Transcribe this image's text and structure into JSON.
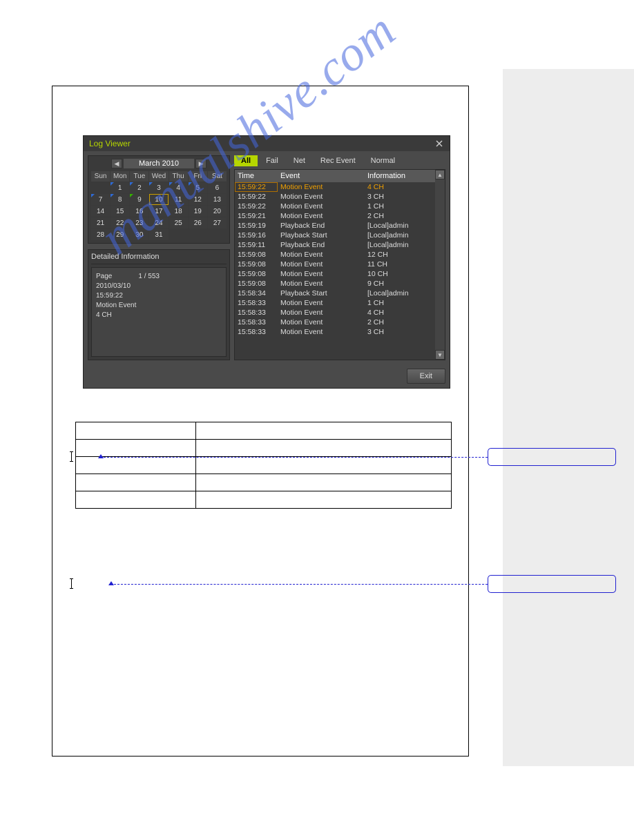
{
  "window": {
    "title": "Log Viewer",
    "exit_label": "Exit"
  },
  "calendar": {
    "month_label": "March 2010",
    "dow": [
      "Sun",
      "Mon",
      "Tue",
      "Wed",
      "Thu",
      "Fri",
      "Sat"
    ],
    "weeks": [
      [
        null,
        {
          "d": "1",
          "m": "blue"
        },
        {
          "d": "2",
          "m": "blue"
        },
        {
          "d": "3",
          "m": "blue"
        },
        {
          "d": "4",
          "m": "blue"
        },
        {
          "d": "5",
          "m": "blue"
        },
        {
          "d": "6"
        }
      ],
      [
        {
          "d": "7",
          "m": "blue"
        },
        {
          "d": "8",
          "m": "blue"
        },
        {
          "d": "9",
          "m": "green"
        },
        {
          "d": "10",
          "sel": true
        },
        {
          "d": "11"
        },
        {
          "d": "12"
        },
        {
          "d": "13"
        }
      ],
      [
        {
          "d": "14"
        },
        {
          "d": "15"
        },
        {
          "d": "16"
        },
        {
          "d": "17"
        },
        {
          "d": "18"
        },
        {
          "d": "19"
        },
        {
          "d": "20"
        }
      ],
      [
        {
          "d": "21"
        },
        {
          "d": "22"
        },
        {
          "d": "23"
        },
        {
          "d": "24"
        },
        {
          "d": "25"
        },
        {
          "d": "26"
        },
        {
          "d": "27"
        }
      ],
      [
        {
          "d": "28"
        },
        {
          "d": "29"
        },
        {
          "d": "30"
        },
        {
          "d": "31"
        },
        null,
        null,
        null
      ]
    ]
  },
  "detail": {
    "title": "Detailed Information",
    "page_label": "Page",
    "page_value": "1 / 553",
    "lines": [
      "2010/03/10",
      "15:59:22",
      "Motion Event",
      " 4 CH"
    ]
  },
  "tabs": [
    {
      "label": "All",
      "active": true
    },
    {
      "label": "Fail"
    },
    {
      "label": "Net"
    },
    {
      "label": "Rec Event"
    },
    {
      "label": "Normal"
    }
  ],
  "log_head": {
    "time": "Time",
    "event": "Event",
    "info": "Information"
  },
  "log_rows": [
    {
      "time": "15:59:22",
      "event": "Motion Event",
      "info": " 4 CH",
      "sel": true
    },
    {
      "time": "15:59:22",
      "event": "Motion Event",
      "info": " 3 CH"
    },
    {
      "time": "15:59:22",
      "event": "Motion Event",
      "info": " 1 CH"
    },
    {
      "time": "15:59:21",
      "event": "Motion Event",
      "info": " 2 CH"
    },
    {
      "time": "15:59:19",
      "event": "Playback End",
      "info": "[Local]admin"
    },
    {
      "time": "15:59:16",
      "event": "Playback Start",
      "info": "[Local]admin"
    },
    {
      "time": "15:59:11",
      "event": "Playback End",
      "info": "[Local]admin"
    },
    {
      "time": "15:59:08",
      "event": "Motion Event",
      "info": " 12 CH"
    },
    {
      "time": "15:59:08",
      "event": "Motion Event",
      "info": " 11 CH"
    },
    {
      "time": "15:59:08",
      "event": "Motion Event",
      "info": " 10 CH"
    },
    {
      "time": "15:59:08",
      "event": "Motion Event",
      "info": " 9 CH"
    },
    {
      "time": "15:58:34",
      "event": "Playback Start",
      "info": "[Local]admin"
    },
    {
      "time": "15:58:33",
      "event": "Motion Event",
      "info": " 1 CH"
    },
    {
      "time": "15:58:33",
      "event": "Motion Event",
      "info": " 4 CH"
    },
    {
      "time": "15:58:33",
      "event": "Motion Event",
      "info": " 2 CH"
    },
    {
      "time": "15:58:33",
      "event": "Motion Event",
      "info": " 3 CH"
    }
  ],
  "watermark": "manualshive.com"
}
